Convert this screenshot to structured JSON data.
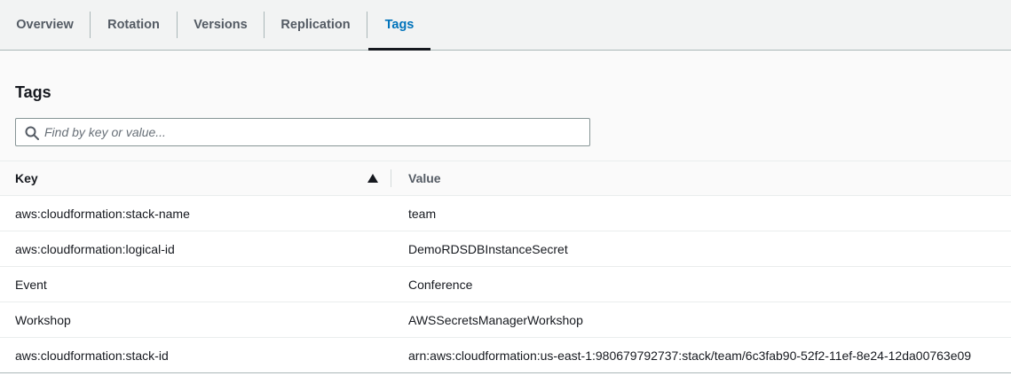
{
  "tabs": [
    {
      "label": "Overview",
      "active": false
    },
    {
      "label": "Rotation",
      "active": false
    },
    {
      "label": "Versions",
      "active": false
    },
    {
      "label": "Replication",
      "active": false
    },
    {
      "label": "Tags",
      "active": true
    }
  ],
  "panel": {
    "title": "Tags",
    "search": {
      "placeholder": "Find by key or value...",
      "value": ""
    }
  },
  "table": {
    "columns": [
      {
        "label": "Key",
        "sorted": "ascending"
      },
      {
        "label": "Value"
      }
    ],
    "rows": [
      {
        "key": "aws:cloudformation:stack-name",
        "value": "team"
      },
      {
        "key": "aws:cloudformation:logical-id",
        "value": "DemoRDSDBInstanceSecret"
      },
      {
        "key": "Event",
        "value": "Conference"
      },
      {
        "key": "Workshop",
        "value": "AWSSecretsManagerWorkshop"
      },
      {
        "key": "aws:cloudformation:stack-id",
        "value": "arn:aws:cloudformation:us-east-1:980679792737:stack/team/6c3fab90-52f2-11ef-8e24-12da00763e09"
      }
    ]
  },
  "icons": {
    "search": "search-icon",
    "sort": "sort-ascending-icon"
  },
  "colors": {
    "active_tab": "#0073bb",
    "text": "#16191f",
    "muted": "#545b64"
  }
}
